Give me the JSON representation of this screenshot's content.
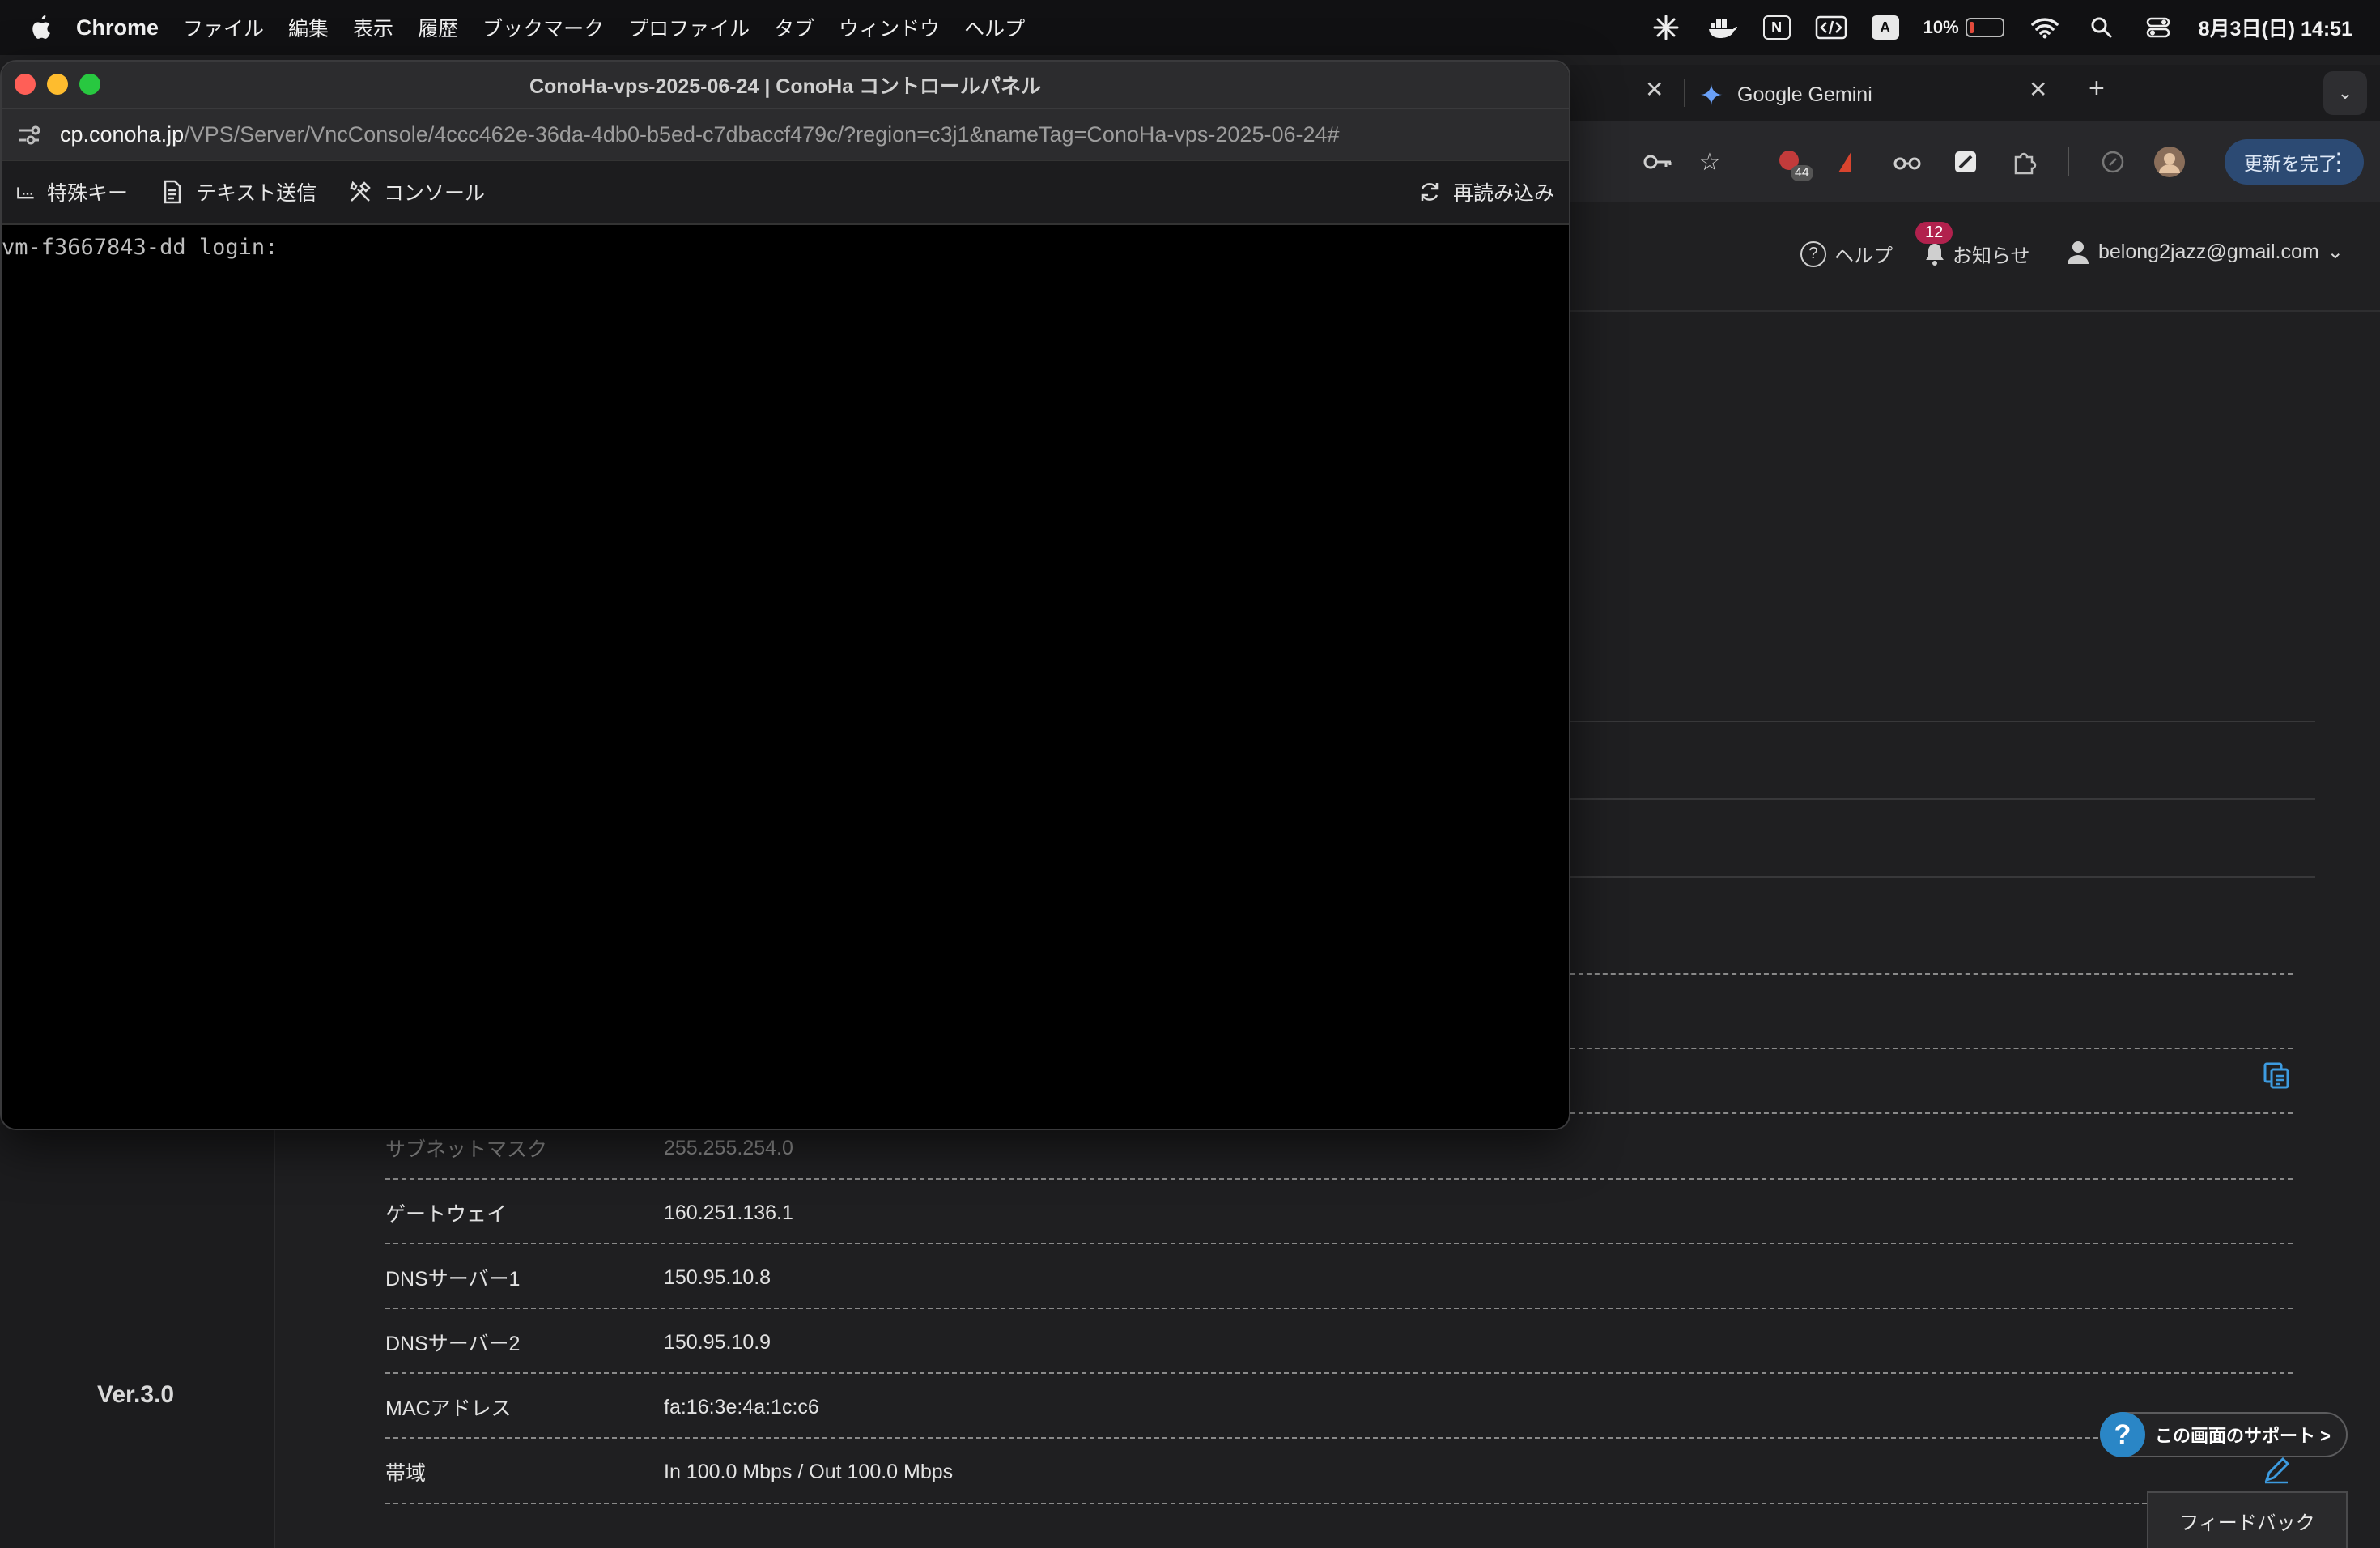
{
  "menubar": {
    "app": "Chrome",
    "items": [
      "ファイル",
      "編集",
      "表示",
      "履歴",
      "ブックマーク",
      "プロファイル",
      "タブ",
      "ウィンドウ",
      "ヘルプ"
    ],
    "status": {
      "n_icon": "N",
      "a_icon": "A",
      "battery_percent": "10%",
      "datetime": "8月3日(日) 14:51"
    }
  },
  "chrome": {
    "tabs": [
      {
        "title": "Google Gemini"
      }
    ],
    "new_tab": "+",
    "update_button": "更新を完了",
    "extension_badge": "44"
  },
  "page_header": {
    "help": "ヘルプ",
    "news": "お知らせ",
    "news_count": "12",
    "user": "belong2jazz@gmail.com"
  },
  "network_rows": [
    {
      "label": "サブネットマスク",
      "value": "255.255.254.0"
    },
    {
      "label": "ゲートウェイ",
      "value": "160.251.136.1"
    },
    {
      "label": "DNSサーバー1",
      "value": "150.95.10.8"
    },
    {
      "label": "DNSサーバー2",
      "value": "150.95.10.9"
    },
    {
      "label": "MACアドレス",
      "value": "fa:16:3e:4a:1c:c6"
    },
    {
      "label": "帯域",
      "value": "In 100.0 Mbps / Out 100.0 Mbps"
    }
  ],
  "sidebar": {
    "version": "Ver.3.0"
  },
  "support": {
    "label": "この画面のサポート >",
    "feedback": "フィードバック"
  },
  "popup": {
    "title": "ConoHa-vps-2025-06-24 | ConoHa コントロールパネル",
    "url_host": "cp.conoha.jp",
    "url_path": "/VPS/Server/VncConsole/4ccc462e-36da-4db0-b5ed-c7dbaccf479c/?region=c3j1&nameTag=ConoHa-vps-2025-06-24#",
    "toolbar": {
      "special_keys": "特殊キー",
      "send_text": "テキスト送信",
      "console": "コンソール",
      "reload": "再読み込み"
    },
    "terminal_text": "vm-f3667843-dd login:"
  }
}
